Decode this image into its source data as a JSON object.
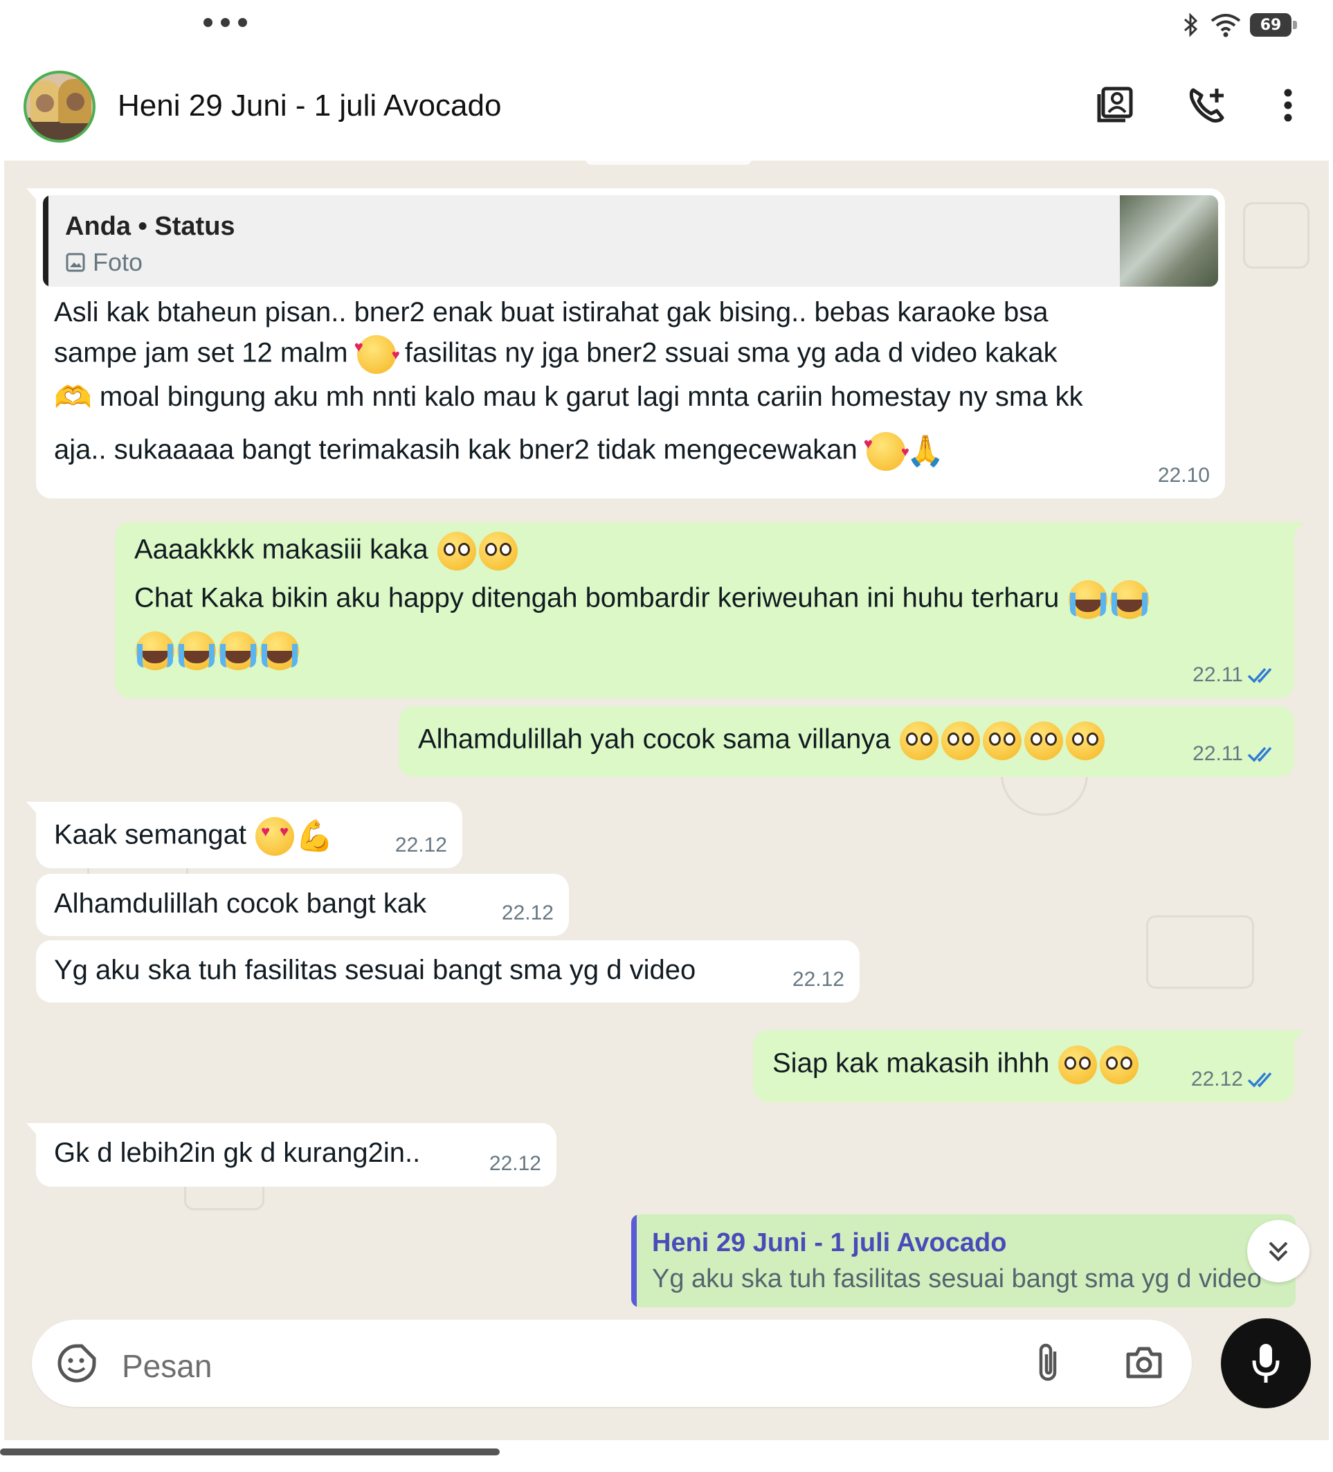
{
  "status_bar": {
    "battery": "69"
  },
  "header": {
    "title": "Heni 29 Juni - 1 juli Avocado"
  },
  "messages": [
    {
      "side": "in",
      "quote_author": "Anda • Status",
      "quote_type": "Foto",
      "text_lines": [
        "Asli kak btaheun pisan.. bner2 enak buat istirahat gak bising.. bebas karaoke bsa",
        "sampe jam set 12 malm",
        "fasilitas ny jga bner2 ssuai sma yg ada d video kakak",
        "moal bingung aku mh nnti kalo mau k garut lagi mnta cariin homestay ny sma kk",
        "aja.. sukaaaaa bangt terimakasih kak bner2 tidak mengecewakan"
      ],
      "time": "22.10"
    },
    {
      "side": "out",
      "text_lines": [
        "Aaaakkkk makasiii kaka",
        "Chat Kaka bikin aku happy ditengah bombardir keriweuhan ini huhu terharu"
      ],
      "time": "22.11",
      "status": "read"
    },
    {
      "side": "out",
      "text": "Alhamdulillah yah cocok sama villanya",
      "time": "22.11",
      "status": "read"
    },
    {
      "side": "in",
      "text": "Kaak semangat",
      "time": "22.12"
    },
    {
      "side": "in",
      "text": "Alhamdulillah cocok bangt kak",
      "time": "22.12"
    },
    {
      "side": "in",
      "text": "Yg aku ska tuh fasilitas sesuai bangt sma yg d video",
      "time": "22.12"
    },
    {
      "side": "out",
      "text": "Siap kak makasih ihhh",
      "time": "22.12",
      "status": "read"
    },
    {
      "side": "in",
      "text": "Gk d lebih2in gk d kurang2in..",
      "time": "22.12"
    }
  ],
  "reply_preview": {
    "author": "Heni 29 Juni - 1 juli Avocado",
    "text": "Yg aku ska tuh fasilitas sesuai bangt sma yg d video"
  },
  "composer": {
    "placeholder": "Pesan"
  },
  "colors": {
    "incoming_bubble": "#ffffff",
    "outgoing_bubble": "#dcf8c6",
    "chat_background": "#efeae2",
    "read_ticks": "#2f7ad6",
    "reply_bar": "#5b5bd6"
  },
  "icons": [
    "contact-card-icon",
    "add-call-icon",
    "more-vert-icon",
    "sticker-icon",
    "attach-icon",
    "camera-icon",
    "mic-icon",
    "double-chevron-down-icon"
  ]
}
